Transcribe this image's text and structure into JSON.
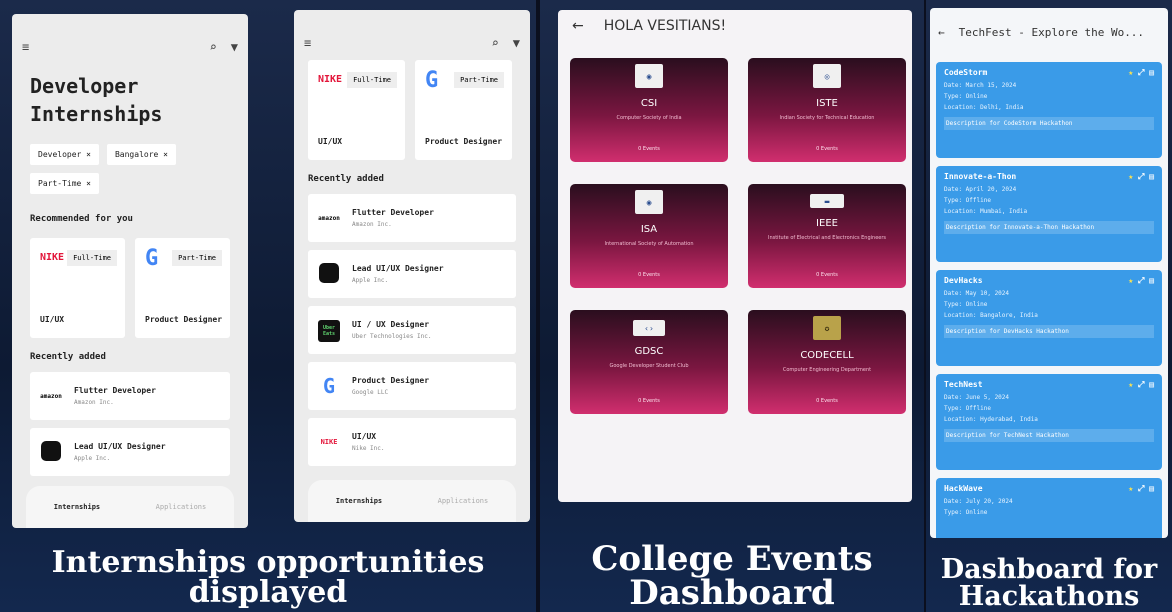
{
  "panel1": {
    "screen_a": {
      "title": "Developer Internships",
      "chips": [
        "Developer ×",
        "Bangalore ×",
        "Part-Time ×"
      ],
      "recommended_label": "Recommended for you",
      "cards": [
        {
          "logo": "NIKE",
          "tag": "Full-Time",
          "role": "UI/UX"
        },
        {
          "logo": "G",
          "tag": "Part-Time",
          "role": "Product Designer"
        }
      ],
      "recent_label": "Recently added",
      "list": [
        {
          "logo": "amazon",
          "title": "Flutter Developer",
          "company": "Amazon Inc."
        },
        {
          "logo": "",
          "title": "Lead UI/UX Designer",
          "company": "Apple Inc."
        }
      ],
      "nav": {
        "active": "Internships",
        "inactive": "Applications"
      }
    },
    "screen_b": {
      "cards": [
        {
          "logo": "NIKE",
          "tag": "Full-Time",
          "role": "UI/UX"
        },
        {
          "logo": "G",
          "tag": "Part-Time",
          "role": "Product Designer"
        }
      ],
      "recent_label": "Recently added",
      "list": [
        {
          "logo": "amazon",
          "title": "Flutter Developer",
          "company": "Amazon Inc."
        },
        {
          "logo": "",
          "title": "Lead UI/UX Designer",
          "company": "Apple Inc."
        },
        {
          "logo": "Uber Eats",
          "title": "UI / UX Designer",
          "company": "Uber Technologies Inc."
        },
        {
          "logo": "G",
          "title": "Product Designer",
          "company": "Google LLC"
        },
        {
          "logo": "NIKE",
          "title": "UI/UX",
          "company": "Nike Inc."
        }
      ],
      "nav": {
        "active": "Internships",
        "inactive": "Applications"
      }
    },
    "caption": "Internships opportunities displayed"
  },
  "panel2": {
    "header": "HOLA VESITIANS!",
    "events": [
      {
        "name": "CSI",
        "sub": "Computer Society of India",
        "count": "0 Events"
      },
      {
        "name": "ISTE",
        "sub": "Indian Society for Technical Education",
        "count": "0 Events"
      },
      {
        "name": "ISA",
        "sub": "International Society of Automation",
        "count": "0 Events"
      },
      {
        "name": "IEEE",
        "sub": "Institute of Electrical and Electronics Engineers",
        "count": "0 Events"
      },
      {
        "name": "GDSC",
        "sub": "Google Developer Student Club",
        "count": "0 Events"
      },
      {
        "name": "CODECELL",
        "sub": "Computer Engineering Department",
        "count": "0 Events"
      }
    ],
    "caption": "College Events Dashboard"
  },
  "panel3": {
    "header": "TechFest - Explore the Wo...",
    "hackathons": [
      {
        "title": "CodeStorm",
        "date": "Date: March 15, 2024",
        "type": "Type: Online",
        "location": "Location: Delhi, India",
        "desc": "Description for CodeStorm Hackathon"
      },
      {
        "title": "Innovate-a-Thon",
        "date": "Date: April 20, 2024",
        "type": "Type: Offline",
        "location": "Location: Mumbai, India",
        "desc": "Description for Innovate-a-Thon Hackathon"
      },
      {
        "title": "DevHacks",
        "date": "Date: May 10, 2024",
        "type": "Type: Online",
        "location": "Location: Bangalore, India",
        "desc": "Description for DevHacks Hackathon"
      },
      {
        "title": "TechNest",
        "date": "Date: June 5, 2024",
        "type": "Type: Offline",
        "location": "Location: Hyderabad, India",
        "desc": "Description for TechNest Hackathon"
      },
      {
        "title": "HackWave",
        "date": "Date: July 20, 2024",
        "type": "Type: Online",
        "location": "",
        "desc": ""
      }
    ],
    "caption": "Dashboard for Hackathons"
  }
}
